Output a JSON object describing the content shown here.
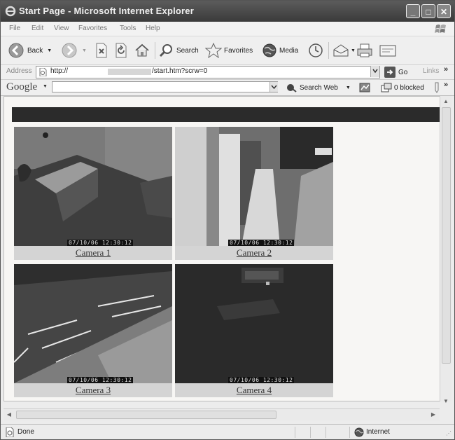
{
  "window": {
    "title": "Start Page - Microsoft Internet Explorer"
  },
  "menu": [
    "File",
    "Edit",
    "View",
    "Favorites",
    "Tools",
    "Help"
  ],
  "toolbar": {
    "back_label": "Back",
    "search_label": "Search",
    "favorites_label": "Favorites",
    "media_label": "Media"
  },
  "address": {
    "label": "Address",
    "url_prefix": "http://",
    "url_suffix": "/start.htm?scrw=0",
    "go_label": "Go",
    "links_label": "Links"
  },
  "google": {
    "logo": "Google",
    "search_web_label": "Search Web",
    "blocked_label": "0 blocked"
  },
  "cameras": [
    {
      "label": "Camera 1",
      "timestamp": "07/10/06 12:30:12"
    },
    {
      "label": "Camera 2",
      "timestamp": "07/10/06 12:30:12"
    },
    {
      "label": "Camera 3",
      "timestamp": "07/10/06 12:30:12"
    },
    {
      "label": "Camera 4",
      "timestamp": "07/10/06 12:30:12"
    }
  ],
  "status": {
    "text": "Done",
    "zone": "Internet"
  }
}
